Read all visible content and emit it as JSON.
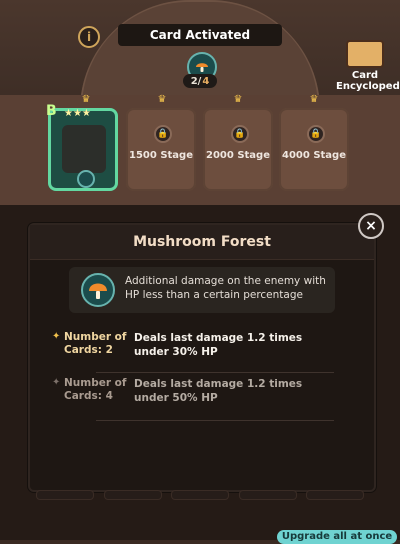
{
  "header": {
    "title": "Card Activated",
    "info_icon": "info-icon",
    "counter_main": "2/",
    "counter_sub": "4",
    "encyclopedia_label_1": "Card",
    "encyclopedia_label_2": "Encyclopedia"
  },
  "slots": [
    {
      "grade": "B",
      "stars": "★★★",
      "unlock": ""
    },
    {
      "unlock": "1500 Stage"
    },
    {
      "unlock": "2000 Stage"
    },
    {
      "unlock": "4000 Stage"
    }
  ],
  "modal": {
    "title": "Mushroom Forest",
    "description": "Additional damage on the enemy with HP less than a certain percentage",
    "bonuses": [
      {
        "label": "Number of Cards: 2",
        "effect": "Deals last damage 1.2 times under 30% HP",
        "state": "active"
      },
      {
        "label": "Number of Cards: 4",
        "effect": "Deals last damage 1.2 times under 50% HP",
        "state": "inactive"
      }
    ]
  },
  "buttons": {
    "close": "×",
    "upgrade": "Upgrade all at once"
  },
  "icons": {
    "mushroom": "mushroom-icon",
    "lock": "lock-icon",
    "crown": "crown-icon",
    "book": "book-icon"
  },
  "colors": {
    "active_slot": "#1e4d43",
    "accent_gold": "#f2c24d",
    "teal": "#67b3ae"
  }
}
